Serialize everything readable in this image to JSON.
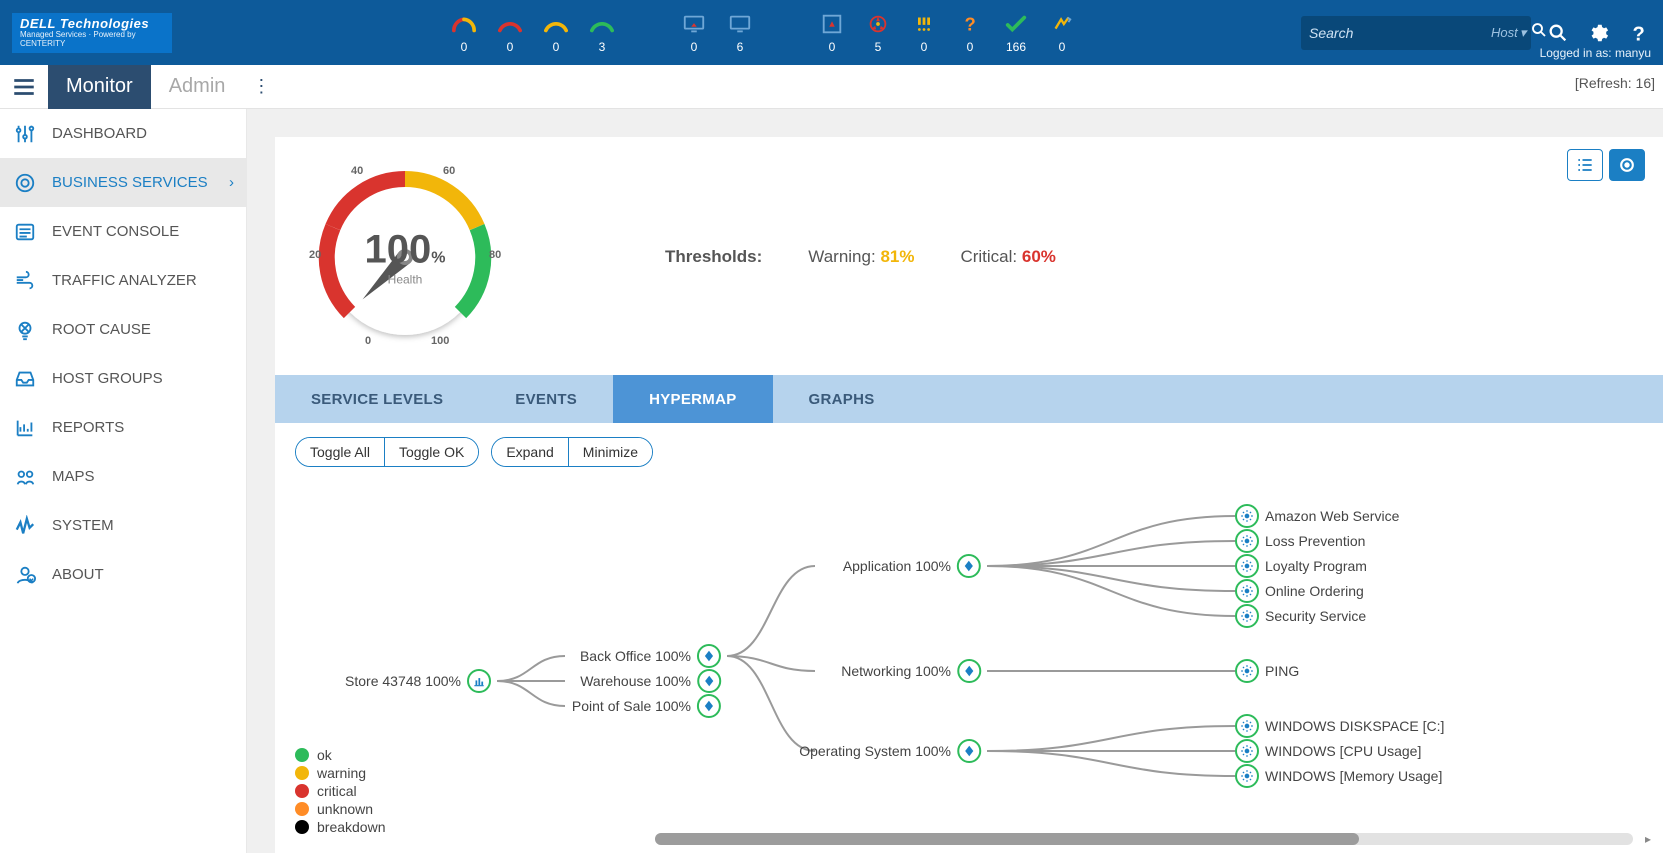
{
  "brand": {
    "line1": "DELL Technologies",
    "line2": "Managed Services · Powered by CENTERITY"
  },
  "top_status": [
    {
      "id": "down-flash",
      "count": 0,
      "colors": [
        "#d9342e",
        "#f2b60a"
      ]
    },
    {
      "id": "down",
      "count": 0,
      "colors": [
        "#d9342e"
      ]
    },
    {
      "id": "unreach",
      "count": 0,
      "colors": [
        "#f2b60a"
      ]
    },
    {
      "id": "up",
      "count": 3,
      "colors": [
        "#2dbb5a"
      ]
    },
    {
      "sep": true
    },
    {
      "id": "sys-down",
      "count": 0,
      "colors": [
        "#d9342e"
      ]
    },
    {
      "id": "sys-up",
      "count": 6,
      "colors": [
        "#6fa7d6"
      ]
    },
    {
      "sep": true
    },
    {
      "id": "svc-crit",
      "count": 0,
      "colors": [
        "#d9342e"
      ]
    },
    {
      "id": "svc-rad",
      "count": 5,
      "colors": [
        "#d9342e",
        "#f2b60a"
      ]
    },
    {
      "id": "svc-warn",
      "count": 0,
      "colors": [
        "#f2b60a"
      ]
    },
    {
      "id": "svc-unk",
      "count": 0,
      "colors": [
        "#ff8c26"
      ]
    },
    {
      "id": "svc-ok",
      "count": 166,
      "colors": [
        "#2dbb5a"
      ]
    },
    {
      "id": "svc-extra",
      "count": 0,
      "colors": [
        "#f2b60a",
        "#6fa7d6"
      ]
    }
  ],
  "search": {
    "placeholder": "Search",
    "scope": "Host"
  },
  "user": {
    "prefix": "Logged in as:",
    "name": "manyu"
  },
  "secbar": {
    "tabs": [
      "Monitor",
      "Admin"
    ],
    "active": 0,
    "refresh": "[Refresh: 16]"
  },
  "sidebar": [
    {
      "icon": "sliders",
      "label": "DASHBOARD"
    },
    {
      "icon": "target",
      "label": "BUSINESS SERVICES",
      "active": true,
      "chevron": true
    },
    {
      "icon": "list",
      "label": "EVENT CONSOLE"
    },
    {
      "icon": "wind",
      "label": "TRAFFIC ANALYZER"
    },
    {
      "icon": "bulb",
      "label": "ROOT CAUSE"
    },
    {
      "icon": "inbox",
      "label": "HOST GROUPS"
    },
    {
      "icon": "chart",
      "label": "REPORTS"
    },
    {
      "icon": "map",
      "label": "MAPS"
    },
    {
      "icon": "pulse",
      "label": "SYSTEM"
    },
    {
      "icon": "about",
      "label": "ABOUT"
    }
  ],
  "gauge": {
    "value": "100",
    "unit": "%",
    "label": "Health",
    "ticks": [
      "0",
      "20",
      "40",
      "60",
      "80",
      "100"
    ]
  },
  "thresholds": {
    "label": "Thresholds:",
    "warning_label": "Warning:",
    "warning": "81%",
    "critical_label": "Critical:",
    "critical": "60%"
  },
  "subtabs": {
    "items": [
      "SERVICE LEVELS",
      "EVENTS",
      "HYPERMAP",
      "GRAPHS"
    ],
    "active": 2
  },
  "toggles": {
    "grp1": [
      "Toggle All",
      "Toggle OK"
    ],
    "grp2": [
      "Expand",
      "Minimize"
    ]
  },
  "legend": [
    {
      "label": "ok",
      "color": "#2dbb5a"
    },
    {
      "label": "warning",
      "color": "#f2b60a"
    },
    {
      "label": "critical",
      "color": "#d9342e"
    },
    {
      "label": "unknown",
      "color": "#ff8c26"
    },
    {
      "label": "breakdown",
      "color": "#000000"
    }
  ],
  "hypermap": {
    "root": {
      "label": "Store 43748 100%",
      "icon": "chart"
    },
    "level2": [
      {
        "label": "Back Office 100%"
      },
      {
        "label": "Warehouse 100%"
      },
      {
        "label": "Point of Sale 100%"
      }
    ],
    "level3": [
      {
        "label": "Application 100%"
      },
      {
        "label": "Networking 100%"
      },
      {
        "label": "Operating System 100%"
      }
    ],
    "apps": [
      {
        "label": "Amazon Web Service"
      },
      {
        "label": "Loss Prevention"
      },
      {
        "label": "Loyalty Program"
      },
      {
        "label": "Online Ordering"
      },
      {
        "label": "Security Service"
      }
    ],
    "net": [
      {
        "label": "PING"
      }
    ],
    "os": [
      {
        "label": "WINDOWS DISKSPACE [C:]"
      },
      {
        "label": "WINDOWS [CPU Usage]"
      },
      {
        "label": "WINDOWS [Memory Usage]"
      }
    ]
  },
  "chart_data": {
    "type": "bar",
    "title": "Health",
    "categories": [
      "Health"
    ],
    "values": [
      100
    ],
    "ylim": [
      0,
      100
    ],
    "thresholds": {
      "warning": 81,
      "critical": 60
    },
    "ylabel": "%"
  }
}
